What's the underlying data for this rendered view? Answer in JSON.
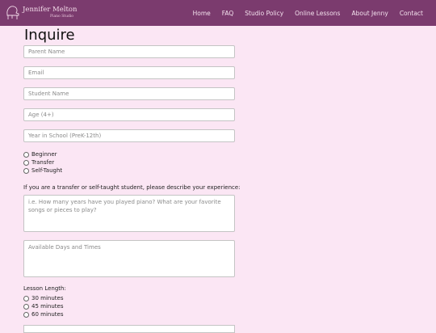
{
  "brand": {
    "name": "Jennifer Melton",
    "tagline": "Piano Studio"
  },
  "nav": {
    "items": [
      "Home",
      "FAQ",
      "Studio Policy",
      "Online Lessons",
      "About Jenny",
      "Contact"
    ]
  },
  "form": {
    "title": "Inquire",
    "fields": {
      "parent_name": "Parent Name",
      "email": "Email",
      "student_name": "Student Name",
      "age": "Age (4+)",
      "school_year": "Year in School (PreK-12th)"
    },
    "experience_options": [
      "Beginner",
      "Transfer",
      "Self-Taught"
    ],
    "experience_prompt": "If you are a transfer or self-taught student, please describe your experience:",
    "experience_placeholder": "i.e. How many years have you played piano? What are your favorite songs or pieces to play?",
    "availability_placeholder": "Available Days and Times",
    "lesson_length_label": "Lesson Length:",
    "lesson_length_options": [
      "30 minutes",
      "45 minutes",
      "60 minutes"
    ]
  },
  "colors": {
    "navbar": "#7b3b6e",
    "background": "#fbe6f4"
  }
}
